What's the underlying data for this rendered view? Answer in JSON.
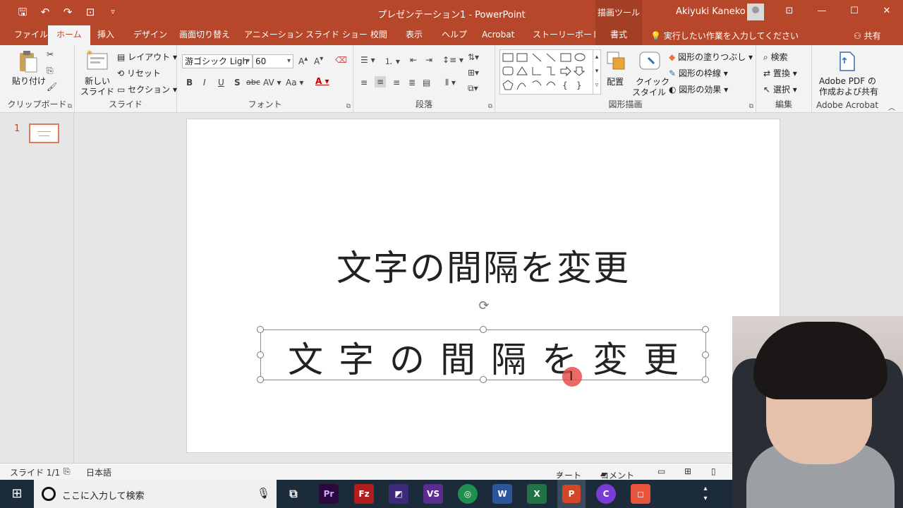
{
  "app": {
    "title": "プレゼンテーション1 - PowerPoint",
    "drawing_tools_label": "描画ツール",
    "user_name": "Akiyuki Kaneko"
  },
  "tabs": [
    "ファイル",
    "ホーム",
    "挿入",
    "デザイン",
    "画面切り替え",
    "アニメーション",
    "スライド ショー",
    "校閲",
    "表示",
    "ヘルプ",
    "Acrobat",
    "ストーリーボード",
    "書式"
  ],
  "active_tab": "ホーム",
  "tell_me": "実行したい作業を入力してください",
  "share": "共有",
  "ribbon": {
    "clipboard": {
      "paste": "貼り付け",
      "label": "クリップボード"
    },
    "slides": {
      "new_slide_1": "新しい",
      "new_slide_2": "スライド",
      "layout": "レイアウト",
      "reset": "リセット",
      "section": "セクション",
      "label": "スライド"
    },
    "font": {
      "font_name": "游ゴシック Ligh",
      "font_size": "60",
      "bold": "B",
      "italic": "I",
      "underline": "U",
      "shadow": "S",
      "strike": "abc",
      "spacing": "AV",
      "case": "Aa",
      "label": "フォント"
    },
    "paragraph": {
      "label": "段落"
    },
    "drawing": {
      "arrange": "配置",
      "quick_style_1": "クイック",
      "quick_style_2": "スタイル",
      "fill": "図形の塗りつぶし",
      "outline": "図形の枠線",
      "effects": "図形の効果",
      "label": "図形描画"
    },
    "editing": {
      "find": "検索",
      "replace": "置換",
      "select": "選択",
      "label": "編集"
    },
    "acrobat": {
      "btn_1": "Adobe PDF の",
      "btn_2": "作成および共有",
      "label": "Adobe Acrobat"
    }
  },
  "slides_pane": {
    "slide_number": "1"
  },
  "slide": {
    "title_text": "文字の間隔を変更",
    "spaced_text": "文字の間隔を変更"
  },
  "status": {
    "slide_info": "スライド 1/1",
    "language": "日本語",
    "notes": "ノート",
    "comments": "コメント"
  },
  "taskbar": {
    "search_placeholder": "ここに入力して検索",
    "apps": [
      "Premiere",
      "FileZilla",
      "Visual Studio",
      "Chrome",
      "Word",
      "Excel",
      "PowerPoint",
      "Camo",
      "Camtasia"
    ]
  },
  "colors": {
    "accent": "#b7472a",
    "ribbon_bg": "#f3f3f3",
    "taskbar_bg": "#1c2b3a"
  }
}
